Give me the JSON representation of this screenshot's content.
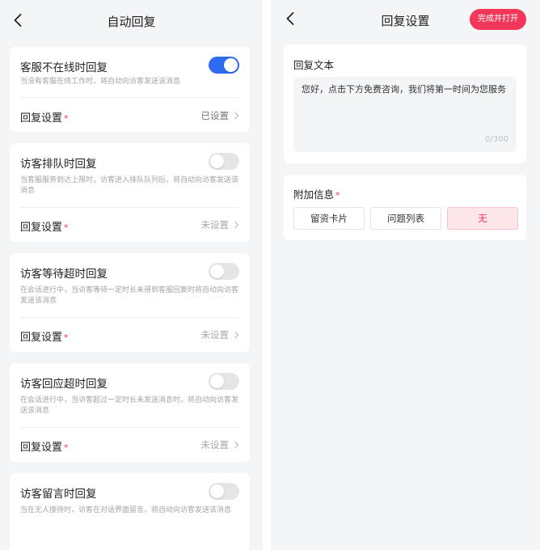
{
  "left": {
    "title": "自动回复",
    "cards": [
      {
        "title": "客服不在线时回复",
        "desc": "当没有客服在线工作时，将自动向访客发送该消息",
        "setting_label": "回复设置",
        "status": "已设置",
        "enabled": true
      },
      {
        "title": "访客排队时回复",
        "desc": "当客服服务到达上限时，访客进入排队队列后，将自动向访客发送该消息",
        "setting_label": "回复设置",
        "status": "未设置",
        "enabled": false
      },
      {
        "title": "访客等待超时回复",
        "desc": "在会话进行中，当访客等待一定时长未得到客服回复时将自动向访客发送该消息",
        "setting_label": "回复设置",
        "status": "未设置",
        "enabled": false
      },
      {
        "title": "访客回应超时回复",
        "desc": "在会话进行中，当访客超过一定时长未发送消息时，将自动向访客发送该消息",
        "setting_label": "回复设置",
        "status": "未设置",
        "enabled": false
      },
      {
        "title": "访客留言时回复",
        "desc": "当在无人接待时，访客在对话界面留言，将自动向访客发送该消息",
        "enabled": false
      }
    ],
    "required_mark": "*"
  },
  "right": {
    "title": "回复设置",
    "finish_button": "完成并打开",
    "reply_text_label": "回复文本",
    "reply_text_value": "您好，点击下方免费咨询，我们将第一时间为您服务",
    "char_counter": "0/300",
    "extra_label": "附加信息",
    "required_mark": "*",
    "options": [
      "留资卡片",
      "问题列表",
      "无"
    ],
    "selected_option": "无"
  },
  "colors": {
    "accent": "#f2375a",
    "toggle_on": "#2e6bf1",
    "background": "#f4f5f7"
  }
}
